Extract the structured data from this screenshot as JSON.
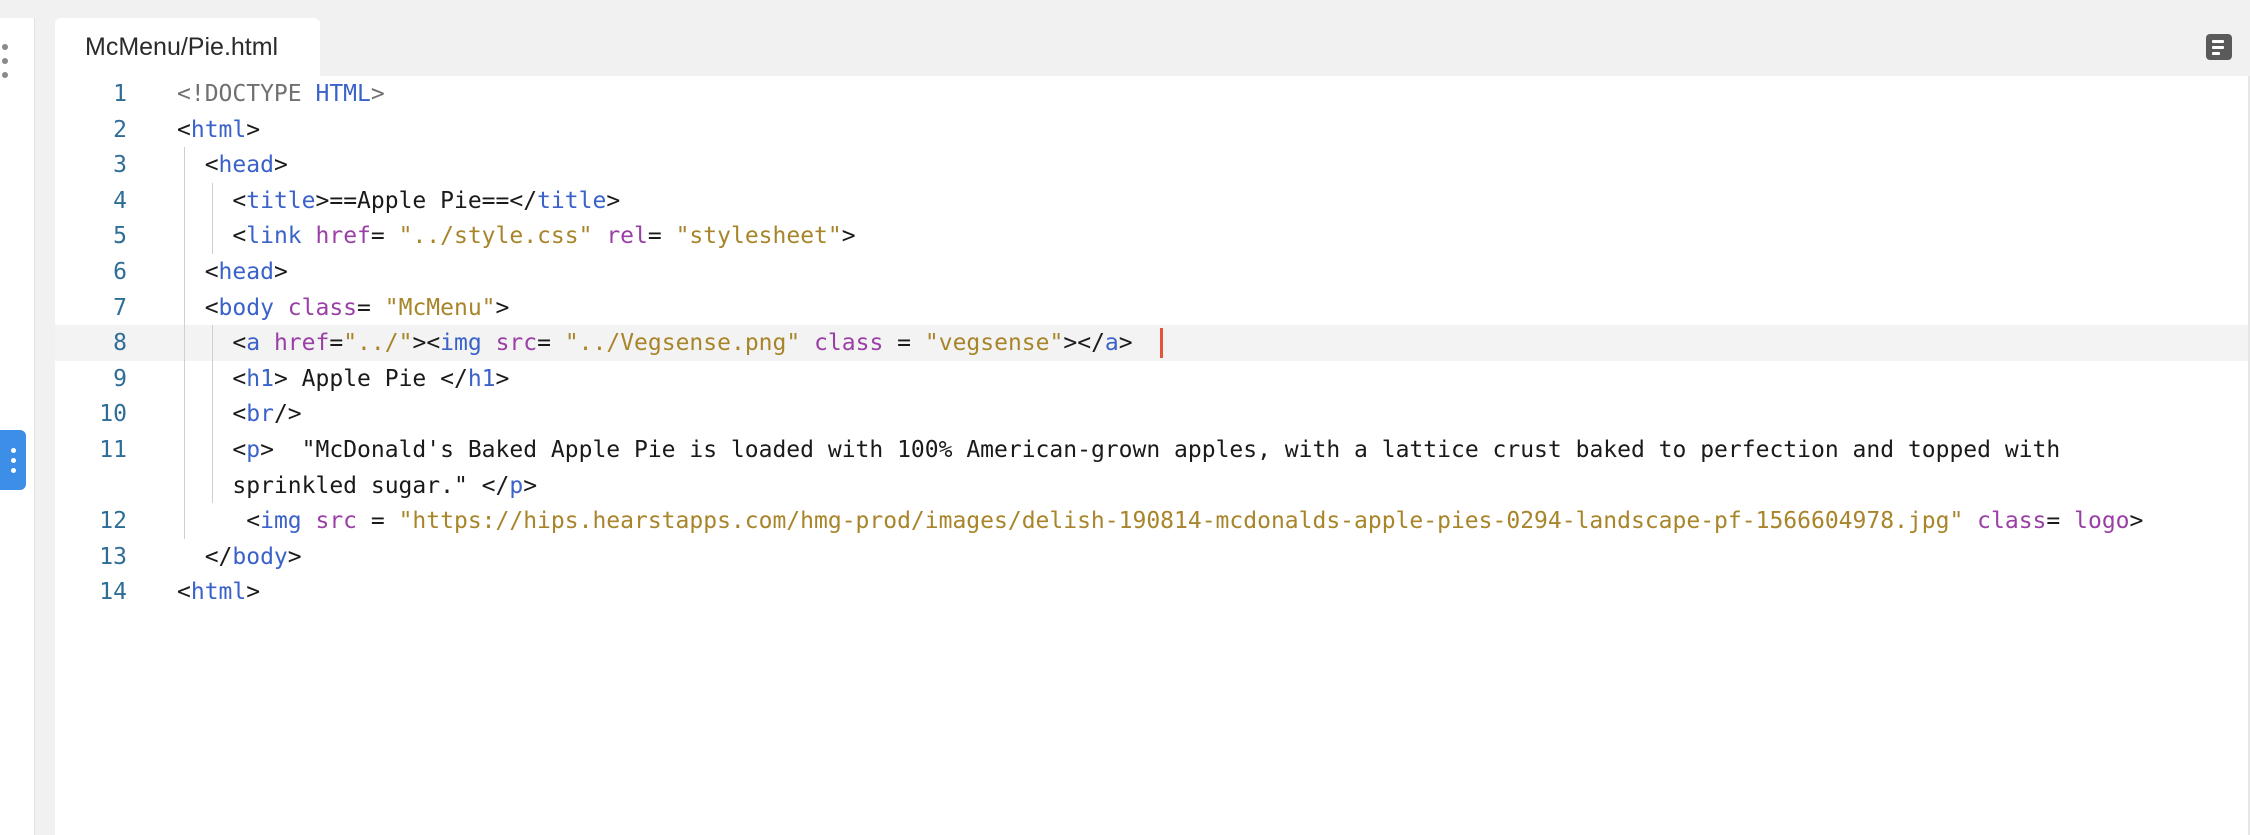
{
  "tab": {
    "title": "McMenu/Pie.html"
  },
  "icons": {
    "rail_menu": "vertical-dots-icon",
    "rail_toggle": "vertical-dots-icon",
    "outline": "outline-list-icon"
  },
  "colors": {
    "accent": "#3c8ee6",
    "caret": "#e2553a",
    "tag": "#3a62c9",
    "attr": "#9a3fa5",
    "string": "#a8852a"
  },
  "lines": [
    {
      "n": "1",
      "tokens": [
        [
          "dt",
          "<!DOCTYPE "
        ],
        [
          "tag",
          "HTML"
        ],
        [
          "dt",
          ">"
        ]
      ]
    },
    {
      "n": "2",
      "tokens": [
        [
          "br",
          "<"
        ],
        [
          "tag",
          "html"
        ],
        [
          "br",
          ">"
        ]
      ]
    },
    {
      "n": "3",
      "tokens": [
        [
          "br",
          "  <"
        ],
        [
          "tag",
          "head"
        ],
        [
          "br",
          ">"
        ]
      ]
    },
    {
      "n": "4",
      "tokens": [
        [
          "br",
          "    <"
        ],
        [
          "tag",
          "title"
        ],
        [
          "br",
          ">==Apple Pie==</"
        ],
        [
          "tag",
          "title"
        ],
        [
          "br",
          ">"
        ]
      ]
    },
    {
      "n": "5",
      "tokens": [
        [
          "br",
          "    <"
        ],
        [
          "tag",
          "link "
        ],
        [
          "attr",
          "href"
        ],
        [
          "br",
          "= "
        ],
        [
          "str",
          "\"../style.css\""
        ],
        [
          "br",
          " "
        ],
        [
          "attr",
          "rel"
        ],
        [
          "br",
          "= "
        ],
        [
          "str",
          "\"stylesheet\""
        ],
        [
          "br",
          ">"
        ]
      ]
    },
    {
      "n": "6",
      "tokens": [
        [
          "br",
          "  <"
        ],
        [
          "tag",
          "head"
        ],
        [
          "br",
          ">"
        ]
      ]
    },
    {
      "n": "7",
      "tokens": [
        [
          "br",
          "  <"
        ],
        [
          "tag",
          "body "
        ],
        [
          "attr",
          "class"
        ],
        [
          "br",
          "= "
        ],
        [
          "str",
          "\"McMenu\""
        ],
        [
          "br",
          ">"
        ]
      ]
    },
    {
      "n": "8",
      "tokens": [
        [
          "br",
          "    <"
        ],
        [
          "tag",
          "a "
        ],
        [
          "attr",
          "href"
        ],
        [
          "br",
          "="
        ],
        [
          "str",
          "\"../\""
        ],
        [
          "br",
          ">"
        ],
        [
          "br",
          "<"
        ],
        [
          "tag",
          "img "
        ],
        [
          "attr",
          "src"
        ],
        [
          "br",
          "= "
        ],
        [
          "str",
          "\"../Vegsense.png\""
        ],
        [
          "br",
          " "
        ],
        [
          "attr",
          "class"
        ],
        [
          "br",
          " = "
        ],
        [
          "str",
          "\"vegsense\""
        ],
        [
          "br",
          ">"
        ],
        [
          "br",
          "</"
        ],
        [
          "tag",
          "a"
        ],
        [
          "br",
          "> "
        ]
      ]
    },
    {
      "n": "9",
      "tokens": [
        [
          "br",
          "    <"
        ],
        [
          "tag",
          "h1"
        ],
        [
          "br",
          "> Apple Pie </"
        ],
        [
          "tag",
          "h1"
        ],
        [
          "br",
          ">"
        ]
      ]
    },
    {
      "n": "10",
      "tokens": [
        [
          "br",
          "    <"
        ],
        [
          "tag",
          "br"
        ],
        [
          "br",
          "/>"
        ]
      ]
    },
    {
      "n": "11",
      "tokens": [
        [
          "br",
          "    <"
        ],
        [
          "tag",
          "p"
        ],
        [
          "br",
          ">  \"McDonald's Baked Apple Pie is loaded with 100% American-grown apples, with a lattice crust baked to perfection and topped with"
        ]
      ]
    },
    {
      "n": "",
      "tokens": [
        [
          "br",
          "    sprinkled sugar.\" </"
        ],
        [
          "tag",
          "p"
        ],
        [
          "br",
          ">"
        ]
      ]
    },
    {
      "n": "12",
      "tokens": [
        [
          "br",
          "     <"
        ],
        [
          "tag",
          "img "
        ],
        [
          "attr",
          "src"
        ],
        [
          "br",
          " = "
        ],
        [
          "str",
          "\"https://hips.hearstapps.com/hmg-prod/images/delish-190814-mcdonalds-apple-pies-0294-landscape-pf-1566604978.jpg\""
        ],
        [
          "br",
          " "
        ],
        [
          "attr",
          "class"
        ],
        [
          "br",
          "= "
        ],
        [
          "attr",
          "logo"
        ],
        [
          "br",
          ">"
        ]
      ]
    },
    {
      "n": "13",
      "tokens": [
        [
          "br",
          "  </"
        ],
        [
          "tag",
          "body"
        ],
        [
          "br",
          ">"
        ]
      ]
    },
    {
      "n": "14",
      "tokens": [
        [
          "br",
          "<"
        ],
        [
          "tag",
          "html"
        ],
        [
          "br",
          ">"
        ]
      ]
    }
  ]
}
